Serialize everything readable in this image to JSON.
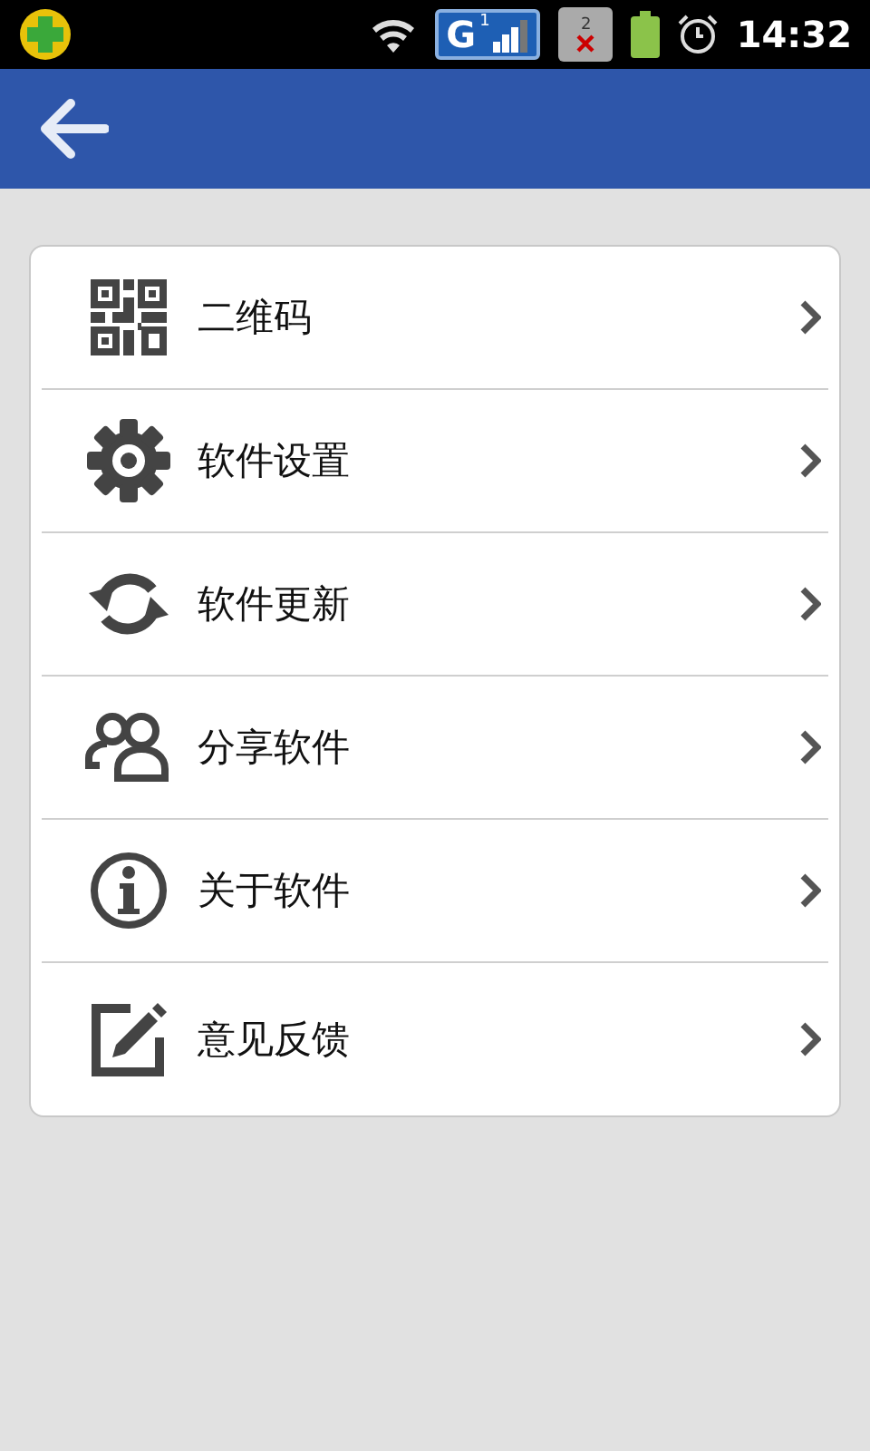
{
  "status_bar": {
    "sim1": {
      "network": "G",
      "slot": "1"
    },
    "sim2": {
      "slot": "2"
    },
    "time": "14:32"
  },
  "menu": [
    {
      "kind": "qr",
      "label": "二维码"
    },
    {
      "kind": "gear",
      "label": "软件设置"
    },
    {
      "kind": "refresh",
      "label": "软件更新"
    },
    {
      "kind": "people",
      "label": "分享软件"
    },
    {
      "kind": "info",
      "label": "关于软件"
    },
    {
      "kind": "edit",
      "label": "意见反馈"
    }
  ]
}
